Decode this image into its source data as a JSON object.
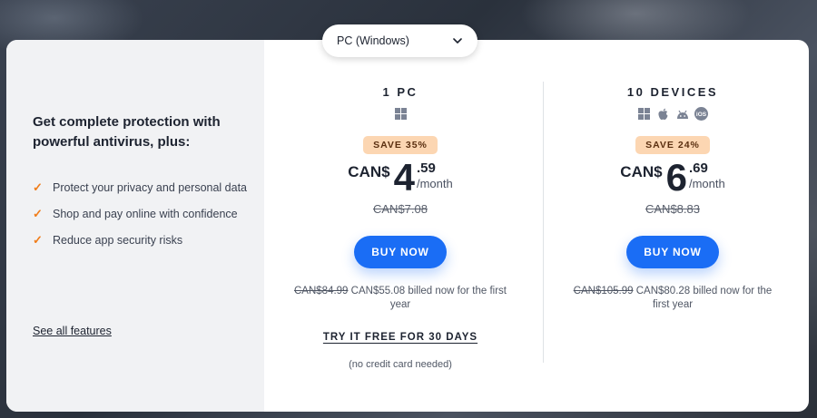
{
  "platform_select": {
    "value": "PC (Windows)",
    "icon": "chevron-down-icon"
  },
  "left": {
    "headline": "Get complete protection with powerful antivirus, plus:",
    "features": [
      "Protect your privacy and personal data",
      "Shop and pay online with confidence",
      "Reduce app security risks"
    ],
    "see_all": "See all features"
  },
  "plans": [
    {
      "title": "1 PC",
      "icons": [
        "windows-icon"
      ],
      "save": "SAVE 35%",
      "currency": "CAN$",
      "price_int": "4",
      "price_cents": ".59",
      "per": "/month",
      "old_price": "CAN$7.08",
      "buy": "BUY NOW",
      "billed_strike": "CAN$84.99",
      "billed_rest": " CAN$55.08 billed now for the first year",
      "trial": "TRY IT FREE FOR 30 DAYS",
      "no_card": "(no credit card needed)"
    },
    {
      "title": "10 DEVICES",
      "icons": [
        "windows-icon",
        "apple-icon",
        "android-icon",
        "ios-icon"
      ],
      "save": "SAVE 24%",
      "currency": "CAN$",
      "price_int": "6",
      "price_cents": ".69",
      "per": "/month",
      "old_price": "CAN$8.83",
      "buy": "BUY NOW",
      "billed_strike": "CAN$105.99",
      "billed_rest": " CAN$80.28 billed now for the first year"
    }
  ],
  "colors": {
    "accent": "#1a6df5",
    "check": "#f07d1a",
    "badge": "#fcd6b2"
  }
}
